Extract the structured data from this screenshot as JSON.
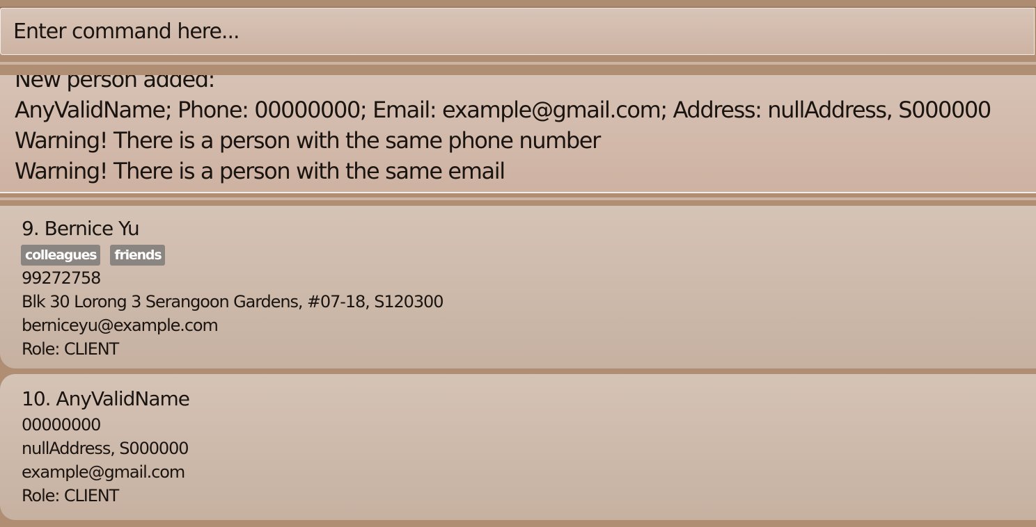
{
  "command": {
    "placeholder": "Enter command here..."
  },
  "result": {
    "lines": [
      "New person added:",
      "AnyValidName; Phone: 00000000; Email: example@gmail.com; Address: nullAddress, S000000",
      "Warning! There is a person with the same phone number",
      "Warning! There is a person with the same email"
    ]
  },
  "persons": [
    {
      "name": "9. Bernice Yu",
      "tags": [
        "colleagues",
        "friends"
      ],
      "phone": "99272758",
      "address": "Blk 30 Lorong 3 Serangoon Gardens, #07-18, S120300",
      "email": "berniceyu@example.com",
      "role": "Role: CLIENT"
    },
    {
      "name": "10. AnyValidName",
      "phone": "00000000",
      "address": "nullAddress, S000000",
      "email": "example@gmail.com",
      "role": "Role: CLIENT"
    }
  ],
  "colors": {
    "background": "#b08e74",
    "card": "#d5c3b6",
    "tag": "#8a8581"
  }
}
